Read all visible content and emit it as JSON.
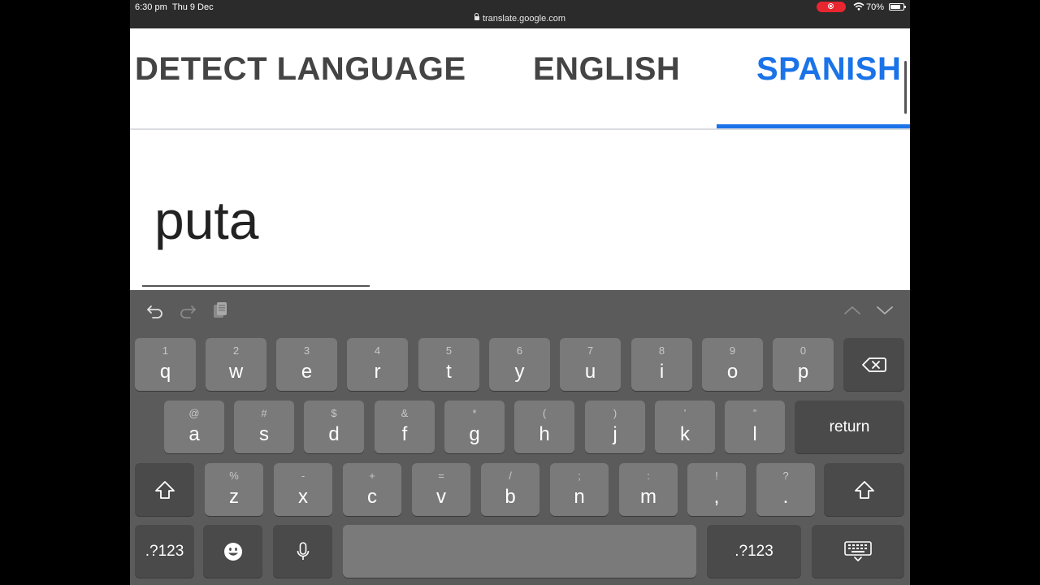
{
  "status_bar": {
    "time": "6:30 pm",
    "date": "Thu 9 Dec",
    "url": "translate.google.com",
    "battery_percent": "70%"
  },
  "language_tabs": {
    "detect": "DETECT LANGUAGE",
    "english": "ENGLISH",
    "spanish": "SPANISH",
    "active": "SPANISH"
  },
  "input_text": "puta",
  "keyboard": {
    "row1": [
      {
        "primary": "q",
        "secondary": "1"
      },
      {
        "primary": "w",
        "secondary": "2"
      },
      {
        "primary": "e",
        "secondary": "3"
      },
      {
        "primary": "r",
        "secondary": "4"
      },
      {
        "primary": "t",
        "secondary": "5"
      },
      {
        "primary": "y",
        "secondary": "6"
      },
      {
        "primary": "u",
        "secondary": "7"
      },
      {
        "primary": "i",
        "secondary": "8"
      },
      {
        "primary": "o",
        "secondary": "9"
      },
      {
        "primary": "p",
        "secondary": "0"
      }
    ],
    "row2": [
      {
        "primary": "a",
        "secondary": "@"
      },
      {
        "primary": "s",
        "secondary": "#"
      },
      {
        "primary": "d",
        "secondary": "$"
      },
      {
        "primary": "f",
        "secondary": "&"
      },
      {
        "primary": "g",
        "secondary": "*"
      },
      {
        "primary": "h",
        "secondary": "("
      },
      {
        "primary": "j",
        "secondary": ")"
      },
      {
        "primary": "k",
        "secondary": "’"
      },
      {
        "primary": "l",
        "secondary": "”"
      }
    ],
    "row3": [
      {
        "primary": "z",
        "secondary": "%"
      },
      {
        "primary": "x",
        "secondary": "-"
      },
      {
        "primary": "c",
        "secondary": "+"
      },
      {
        "primary": "v",
        "secondary": "="
      },
      {
        "primary": "b",
        "secondary": "/"
      },
      {
        "primary": "n",
        "secondary": ";"
      },
      {
        "primary": "m",
        "secondary": ":"
      },
      {
        "primary": ",",
        "secondary": "!"
      },
      {
        "primary": ".",
        "secondary": "?"
      }
    ],
    "return_label": "return",
    "numbers_label": ".?123"
  },
  "icons": {
    "undo": "undo-icon",
    "redo": "redo-icon",
    "paste": "clipboard-icon",
    "prev": "chevron-up-icon",
    "next": "chevron-down-icon",
    "backspace": "backspace-icon",
    "shift": "shift-icon",
    "emoji": "emoji-icon",
    "mic": "microphone-icon",
    "dismiss": "keyboard-dismiss-icon"
  },
  "colors": {
    "accent": "#1a73e8",
    "recording": "#e8262f",
    "keyboard_bg": "#5b5b5b",
    "key_light": "#7a7a7a",
    "key_dark": "#4a4a4a"
  }
}
